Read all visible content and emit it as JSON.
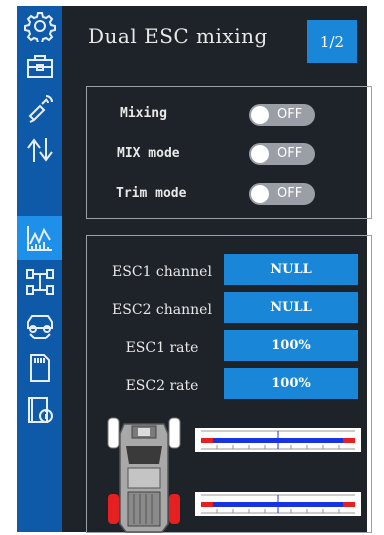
{
  "sidebar": {
    "items": [
      {
        "icon": "gear-icon"
      },
      {
        "icon": "toolbox-icon"
      },
      {
        "icon": "transmitter-icon"
      },
      {
        "icon": "up-down-arrows-icon"
      },
      {
        "icon": "mixing-chart-icon"
      },
      {
        "icon": "chassis-icon"
      },
      {
        "icon": "car-icon"
      },
      {
        "icon": "sd-card-icon"
      },
      {
        "icon": "info-icon"
      }
    ],
    "active_index": 4
  },
  "header": {
    "title": "Dual ESC mixing",
    "page": "1/2"
  },
  "mixing_panel": {
    "rows": [
      {
        "label": "Mixing",
        "state": "OFF"
      },
      {
        "label": "MIX mode",
        "state": "OFF"
      },
      {
        "label": "Trim mode",
        "state": "OFF"
      }
    ]
  },
  "esc_panel": {
    "rows": [
      {
        "label": "ESC1 channel",
        "value": "NULL"
      },
      {
        "label": "ESC2 channel",
        "value": "NULL"
      },
      {
        "label": "ESC1 rate",
        "value": "100%"
      },
      {
        "label": "ESC2 rate",
        "value": "100%"
      }
    ]
  },
  "trim_bars": [
    {
      "value": 0.5
    },
    {
      "value": 0.5
    }
  ],
  "colors": {
    "background": "#1e2329",
    "sidebar": "#0f5aa8",
    "accent": "#1a86d8",
    "bar_blue": "#1a33e0",
    "bar_red": "#e62020",
    "toggle_off": "#9a9ea6"
  }
}
